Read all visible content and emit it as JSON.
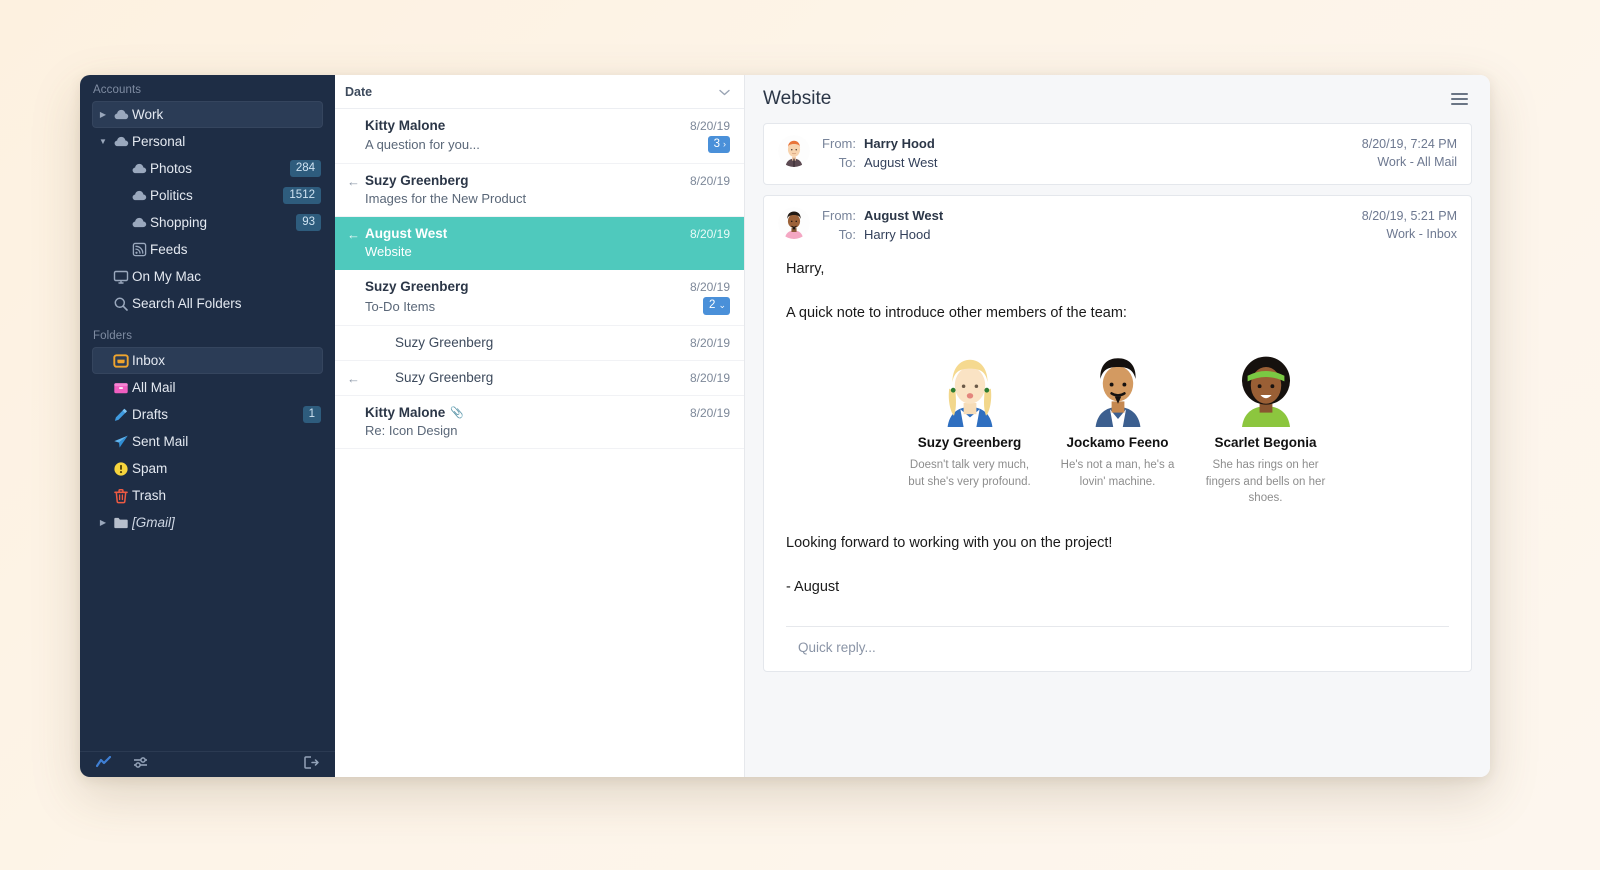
{
  "sidebar": {
    "accounts_header": "Accounts",
    "accounts": [
      {
        "label": "Work",
        "icon": "cloud-icon",
        "twisty": "collapsed",
        "badge": null,
        "indent": 0,
        "selected": true
      },
      {
        "label": "Personal",
        "icon": "cloud-icon",
        "twisty": "expanded",
        "badge": null,
        "indent": 0,
        "selected": false
      },
      {
        "label": "Photos",
        "icon": "cloud-icon",
        "twisty": "none",
        "badge": "284",
        "indent": 1,
        "selected": false
      },
      {
        "label": "Politics",
        "icon": "cloud-icon",
        "twisty": "none",
        "badge": "1512",
        "indent": 1,
        "selected": false
      },
      {
        "label": "Shopping",
        "icon": "cloud-icon",
        "twisty": "none",
        "badge": "93",
        "indent": 1,
        "selected": false
      },
      {
        "label": "Feeds",
        "icon": "rss-icon",
        "twisty": "none",
        "badge": null,
        "indent": 1,
        "selected": false
      },
      {
        "label": "On My Mac",
        "icon": "display-icon",
        "twisty": "none",
        "badge": null,
        "indent": 0,
        "selected": false
      },
      {
        "label": "Search All Folders",
        "icon": "search-icon",
        "twisty": "none",
        "badge": null,
        "indent": 0,
        "selected": false
      }
    ],
    "folders_header": "Folders",
    "folders": [
      {
        "label": "Inbox",
        "icon": "inbox-icon",
        "twisty": "none",
        "badge": null,
        "selected": true,
        "italic": false
      },
      {
        "label": "All Mail",
        "icon": "all-mail-icon",
        "twisty": "none",
        "badge": null,
        "selected": false,
        "italic": false
      },
      {
        "label": "Drafts",
        "icon": "pencil-icon",
        "twisty": "none",
        "badge": "1",
        "selected": false,
        "italic": false
      },
      {
        "label": "Sent Mail",
        "icon": "paper-plane-icon",
        "twisty": "none",
        "badge": null,
        "selected": false,
        "italic": false
      },
      {
        "label": "Spam",
        "icon": "warning-icon",
        "twisty": "none",
        "badge": null,
        "selected": false,
        "italic": false
      },
      {
        "label": "Trash",
        "icon": "trash-icon",
        "twisty": "none",
        "badge": null,
        "selected": false,
        "italic": false
      },
      {
        "label": "[Gmail]",
        "icon": "folder-icon",
        "twisty": "collapsed",
        "badge": null,
        "selected": false,
        "italic": true
      }
    ],
    "bottom_icons": [
      "activity-icon",
      "filter-icon",
      "compose-icon"
    ],
    "colors": {
      "background": "#1e2d45",
      "selected_row": "#2b3c56",
      "badge": "#2e5c7d"
    }
  },
  "message_list": {
    "sort_label": "Date",
    "sort_chevron": "chevron-down-icon",
    "messages": [
      {
        "from": "Kitty Malone",
        "subject": "A question for you...",
        "date": "8/20/19",
        "replied": false,
        "attachment": false,
        "thread_count": "3",
        "thread_chevron": "›",
        "selected": false,
        "sub": false
      },
      {
        "from": "Suzy Greenberg",
        "subject": "Images for the New Product",
        "date": "8/20/19",
        "replied": true,
        "attachment": false,
        "thread_count": null,
        "thread_chevron": null,
        "selected": false,
        "sub": false
      },
      {
        "from": "August West",
        "subject": "Website",
        "date": "8/20/19",
        "replied": true,
        "attachment": false,
        "thread_count": null,
        "thread_chevron": null,
        "selected": true,
        "sub": false
      },
      {
        "from": "Suzy Greenberg",
        "subject": "To-Do Items",
        "date": "8/20/19",
        "replied": false,
        "attachment": false,
        "thread_count": "2",
        "thread_chevron": "⌄",
        "selected": false,
        "sub": false
      },
      {
        "from": "Suzy Greenberg",
        "subject": null,
        "date": "8/20/19",
        "replied": false,
        "attachment": false,
        "thread_count": null,
        "thread_chevron": null,
        "selected": false,
        "sub": true
      },
      {
        "from": "Suzy Greenberg",
        "subject": null,
        "date": "8/20/19",
        "replied": true,
        "attachment": false,
        "thread_count": null,
        "thread_chevron": null,
        "selected": false,
        "sub": true
      },
      {
        "from": "Kitty Malone",
        "subject": "Re: Icon Design",
        "date": "8/20/19",
        "replied": false,
        "attachment": true,
        "thread_count": null,
        "thread_chevron": null,
        "selected": false,
        "sub": false
      }
    ],
    "colors": {
      "selected_row": "#4fc9bd",
      "thread_badge": "#4a90d9"
    }
  },
  "reader": {
    "title": "Website",
    "menu_icon": "hamburger-icon",
    "messages": [
      {
        "avatar": "avatar-harry-hood",
        "from_label": "From:",
        "from": "Harry Hood",
        "to_label": "To:",
        "to": "August West",
        "timestamp": "8/20/19, 7:24 PM",
        "mailbox": "Work - All Mail",
        "expanded": false
      },
      {
        "avatar": "avatar-august-west",
        "from_label": "From:",
        "from": "August West",
        "to_label": "To:",
        "to": "Harry Hood",
        "timestamp": "8/20/19, 5:21 PM",
        "mailbox": "Work - Inbox",
        "expanded": true
      }
    ],
    "body": {
      "greeting": "Harry,",
      "intro": "A quick note to introduce other members of the team:",
      "team": [
        {
          "avatar": "avatar-suzy-greenberg",
          "name": "Suzy Greenberg",
          "description": "Doesn't talk very much, but she's very profound."
        },
        {
          "avatar": "avatar-jockamo-feeno",
          "name": "Jockamo Feeno",
          "description": "He's not a man, he's a lovin' machine."
        },
        {
          "avatar": "avatar-scarlet-begonia",
          "name": "Scarlet Begonia",
          "description": "She has rings on her fingers and bells on her shoes."
        }
      ],
      "closing": "Looking forward to working with you on the project!",
      "signature": "- August"
    },
    "quick_reply_placeholder": "Quick reply..."
  }
}
